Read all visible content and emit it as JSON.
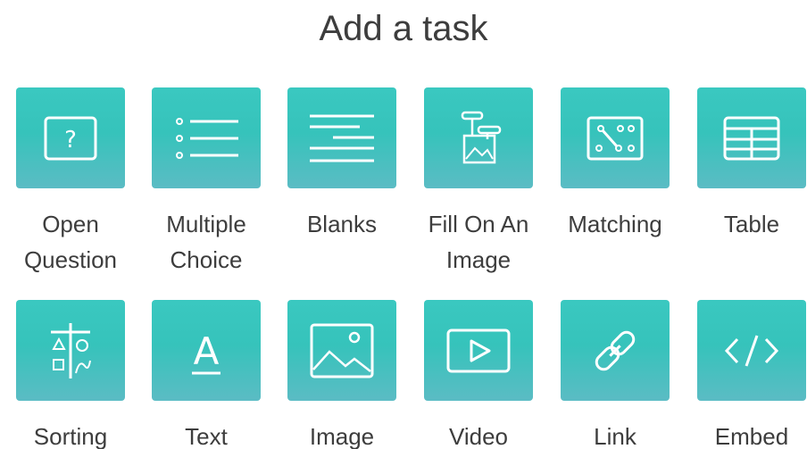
{
  "page": {
    "title": "Add a task"
  },
  "colors": {
    "tile_top": "#3ac8c0",
    "tile_bottom": "#5bbcc4",
    "text": "#3d3d3d",
    "icon": "#ffffff"
  },
  "tasks": [
    {
      "label_line1": "Open",
      "label_line2": "Question",
      "icon": "question-box-icon"
    },
    {
      "label_line1": "Multiple",
      "label_line2": "Choice",
      "icon": "bullet-list-icon"
    },
    {
      "label_line1": "Blanks",
      "label_line2": "",
      "icon": "blank-lines-icon"
    },
    {
      "label_line1": "Fill On An",
      "label_line2": "Image",
      "icon": "image-labels-icon"
    },
    {
      "label_line1": "Matching",
      "label_line2": "",
      "icon": "matching-dots-icon"
    },
    {
      "label_line1": "Table",
      "label_line2": "",
      "icon": "table-icon"
    },
    {
      "label_line1": "Sorting",
      "label_line2": "",
      "icon": "sorting-shapes-icon"
    },
    {
      "label_line1": "Text",
      "label_line2": "",
      "icon": "text-a-icon"
    },
    {
      "label_line1": "Image",
      "label_line2": "",
      "icon": "picture-icon"
    },
    {
      "label_line1": "Video",
      "label_line2": "",
      "icon": "video-play-icon"
    },
    {
      "label_line1": "Link",
      "label_line2": "",
      "icon": "chain-link-icon"
    },
    {
      "label_line1": "Embed",
      "label_line2": "",
      "icon": "code-brackets-icon"
    }
  ]
}
